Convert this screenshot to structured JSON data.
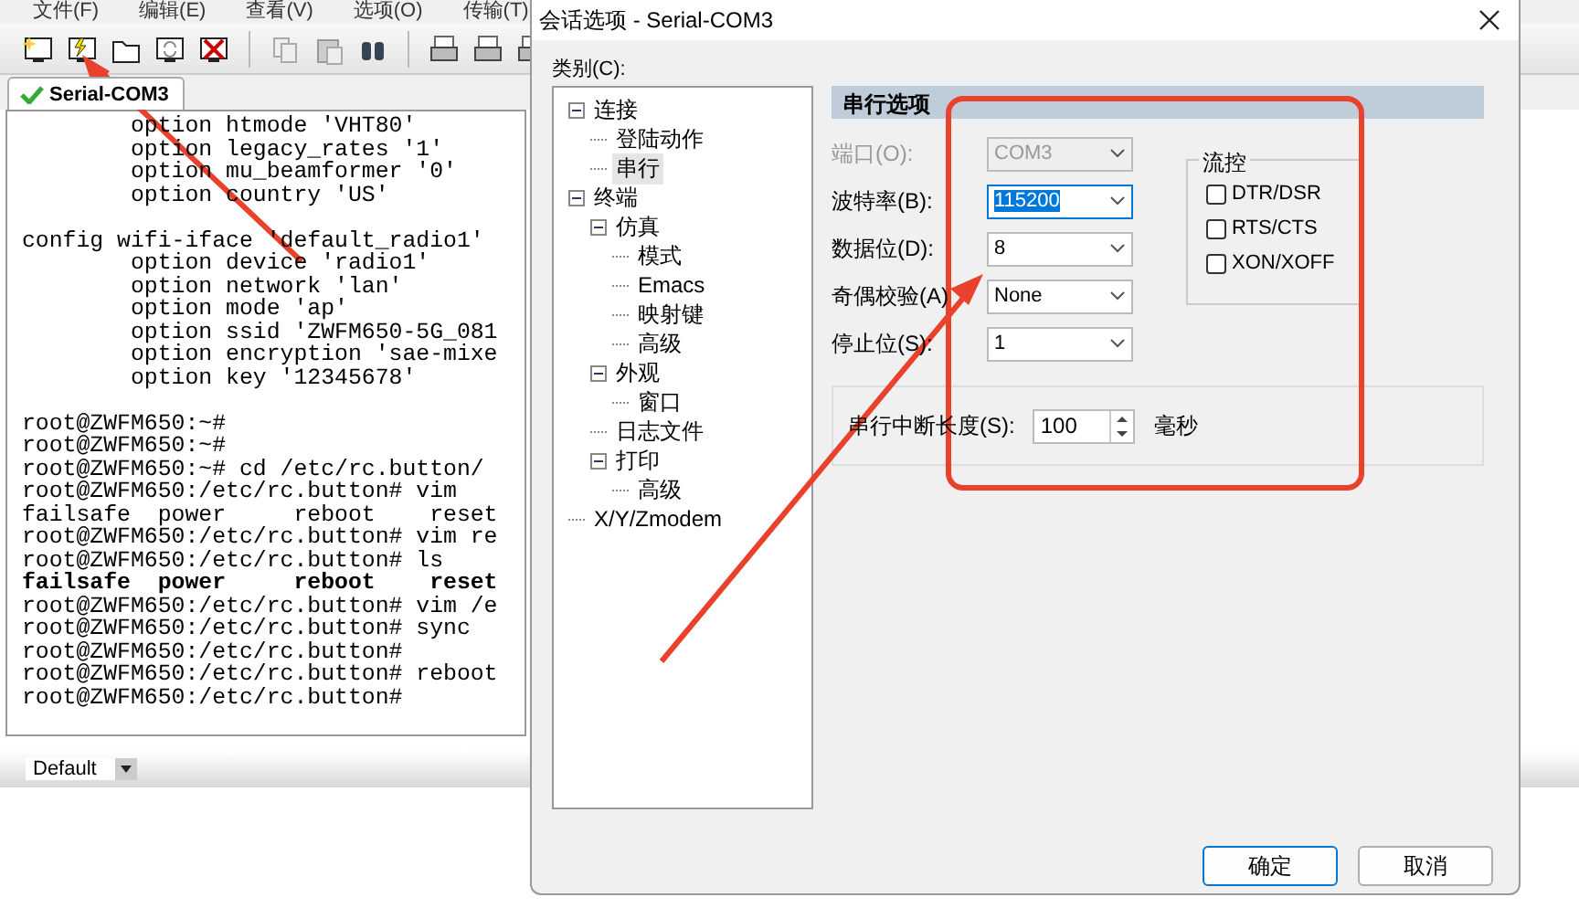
{
  "app": {
    "menu": [
      "文件(F)",
      "编辑(E)",
      "查看(V)",
      "选项(O)",
      "传输(T)"
    ],
    "tab": {
      "label": "Serial-COM3",
      "selected": true
    },
    "terminal": {
      "blocks": [
        [
          {
            "text": "        option htmode 'VHT80'",
            "bold": false
          },
          {
            "text": "        option legacy_rates '1'",
            "bold": false
          },
          {
            "text": "        option mu_beamformer '0'",
            "bold": false
          },
          {
            "text": "        option country 'US'",
            "bold": false
          }
        ],
        [
          {
            "text": "config wifi-iface 'default_radio1'",
            "bold": false
          },
          {
            "text": "        option device 'radio1'",
            "bold": false
          },
          {
            "text": "        option network 'lan'",
            "bold": false
          },
          {
            "text": "        option mode 'ap'",
            "bold": false
          },
          {
            "text": "        option ssid 'ZWFM650-5G_081",
            "bold": false
          },
          {
            "text": "        option encryption 'sae-mixe",
            "bold": false
          },
          {
            "text": "        option key '12345678'",
            "bold": false
          }
        ],
        [
          {
            "text": "root@ZWFM650:~#",
            "bold": false
          },
          {
            "text": "root@ZWFM650:~#",
            "bold": false
          },
          {
            "text": "root@ZWFM650:~# cd /etc/rc.button/",
            "bold": false
          },
          {
            "text": "root@ZWFM650:/etc/rc.button# vim",
            "bold": false
          },
          {
            "text": "failsafe  power     reboot    reset",
            "bold": false
          },
          {
            "text": "root@ZWFM650:/etc/rc.button# vim re",
            "bold": false
          },
          {
            "text": "root@ZWFM650:/etc/rc.button# ls",
            "bold": false
          },
          {
            "text": "failsafe  power     reboot    reset",
            "bold": true
          },
          {
            "text": "root@ZWFM650:/etc/rc.button# vim /e",
            "bold": false
          },
          {
            "text": "root@ZWFM650:/etc/rc.button# sync",
            "bold": false
          },
          {
            "text": "root@ZWFM650:/etc/rc.button#",
            "bold": false
          },
          {
            "text": "root@ZWFM650:/etc/rc.button# reboot",
            "bold": false
          },
          {
            "text": "root@ZWFM650:/etc/rc.button#",
            "bold": false
          }
        ]
      ]
    },
    "session_dropdown": {
      "value": "Default"
    }
  },
  "dialog": {
    "title": "会话选项 - Serial-COM3",
    "category_label": "类别(C):",
    "tree": [
      {
        "label": "连接",
        "selected": false,
        "expanded": true,
        "children": [
          {
            "label": "登陆动作",
            "selected": false
          },
          {
            "label": "串行",
            "selected": true
          }
        ]
      },
      {
        "label": "终端",
        "selected": false,
        "expanded": true,
        "children": [
          {
            "label": "仿真",
            "selected": false,
            "expanded": true,
            "children": [
              {
                "label": "模式",
                "selected": false
              },
              {
                "label": "Emacs",
                "selected": false
              },
              {
                "label": "映射键",
                "selected": false
              },
              {
                "label": "高级",
                "selected": false
              }
            ]
          },
          {
            "label": "外观",
            "selected": false,
            "expanded": true,
            "children": [
              {
                "label": "窗口",
                "selected": false
              }
            ]
          },
          {
            "label": "日志文件",
            "selected": false
          },
          {
            "label": "打印",
            "selected": false,
            "expanded": true,
            "children": [
              {
                "label": "高级",
                "selected": false
              }
            ]
          }
        ]
      },
      {
        "label": "X/Y/Zmodem",
        "selected": false
      }
    ],
    "section_title": "串行选项",
    "fields": [
      {
        "label": "端口(O):",
        "value": "COM3",
        "disabled": true,
        "highlighted": false
      },
      {
        "label": "波特率(B):",
        "value": "115200",
        "disabled": false,
        "highlighted": true
      },
      {
        "label": "数据位(D):",
        "value": "8",
        "disabled": false,
        "highlighted": false
      },
      {
        "label": "奇偶校验(A)",
        "value": "None",
        "disabled": false,
        "highlighted": false
      },
      {
        "label": "停止位(S):",
        "value": "1",
        "disabled": false,
        "highlighted": false
      }
    ],
    "flow_control": {
      "title": "流控",
      "options": [
        {
          "label": "DTR/DSR",
          "checked": false
        },
        {
          "label": "RTS/CTS",
          "checked": false
        },
        {
          "label": "XON/XOFF",
          "checked": false
        }
      ]
    },
    "break_length": {
      "label": "串行中断长度(S):",
      "value": "100",
      "unit": "毫秒"
    },
    "buttons": [
      {
        "label": "确定",
        "default": true
      },
      {
        "label": "取消",
        "default": false
      }
    ]
  }
}
